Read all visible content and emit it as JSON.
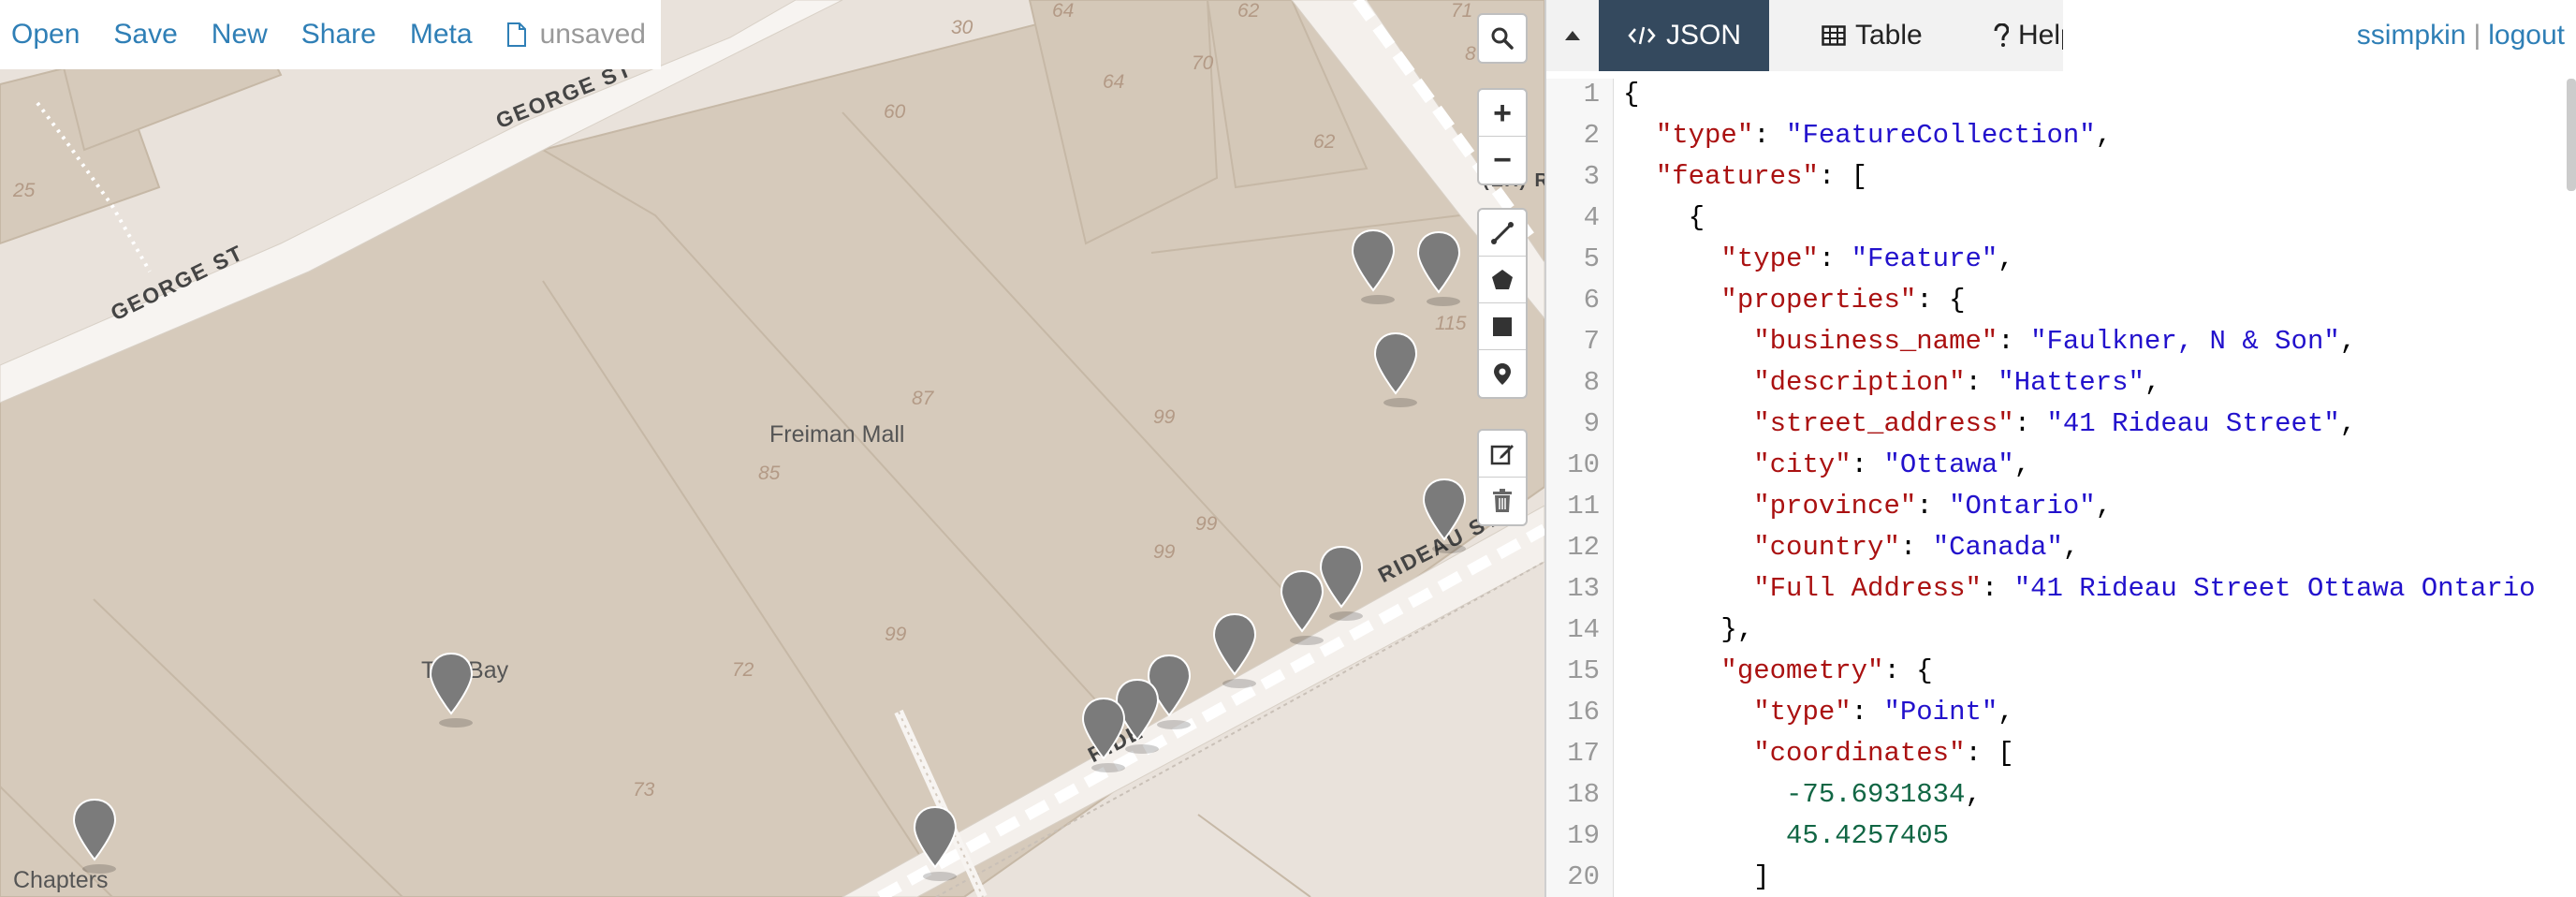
{
  "menu": {
    "open": "Open",
    "save": "Save",
    "new": "New",
    "share": "Share",
    "meta": "Meta",
    "file_status": "unsaved"
  },
  "map": {
    "streets": {
      "george_st_1": "GEORGE ST",
      "george_st_2": "GEORGE ST",
      "rideau_st_1": "RIDEAU ST",
      "rideau_st_2": "RIDE",
      "edge_label": "(EX) R"
    },
    "pois": {
      "freiman_mall": "Freiman Mall",
      "the_bay": "The Bay",
      "chapters": "Chapters"
    },
    "building_numbers": [
      "30",
      "64",
      "62",
      "71",
      "8",
      "64",
      "70",
      "62",
      "60",
      "25",
      "115",
      "87",
      "99",
      "85",
      "99",
      "99",
      "99",
      "72",
      "73"
    ],
    "marker_icon": "map-marker-icon"
  },
  "controls": {
    "search_icon": "search-icon",
    "zoom_in": "+",
    "zoom_out": "−",
    "draw_tools": [
      "draw-line-icon",
      "draw-polygon-icon",
      "draw-rectangle-icon",
      "draw-marker-icon"
    ],
    "edit_tools": [
      "edit-layers-icon",
      "delete-layers-icon"
    ]
  },
  "panel": {
    "tabs": {
      "json": "JSON",
      "table": "Table",
      "help": "Help"
    },
    "user": {
      "name": "ssimpkin",
      "separator": "|",
      "logout": "logout"
    },
    "active_tab_color": "#34495e",
    "link_color": "#2f7fb6"
  },
  "editor": {
    "line_numbers": [
      "1",
      "2",
      "3",
      "4",
      "5",
      "6",
      "7",
      "8",
      "9",
      "10",
      "11",
      "12",
      "13",
      "14",
      "15",
      "16",
      "17",
      "18",
      "19",
      "20"
    ],
    "lines": [
      "{",
      "  \"type\": \"FeatureCollection\",",
      "  \"features\": [",
      "    {",
      "      \"type\": \"Feature\",",
      "      \"properties\": {",
      "        \"business_name\": \"Faulkner, N & Son\",",
      "        \"description\": \"Hatters\",",
      "        \"street_address\": \"41 Rideau Street\",",
      "        \"city\": \"Ottawa\",",
      "        \"province\": \"Ontario\",",
      "        \"country\": \"Canada\",",
      "        \"Full Address\": \"41 Rideau Street Ottawa Ontario",
      "      },",
      "      \"geometry\": {",
      "        \"type\": \"Point\",",
      "        \"coordinates\": [",
      "          -75.6931834,",
      "          45.4257405",
      "        ]"
    ]
  }
}
